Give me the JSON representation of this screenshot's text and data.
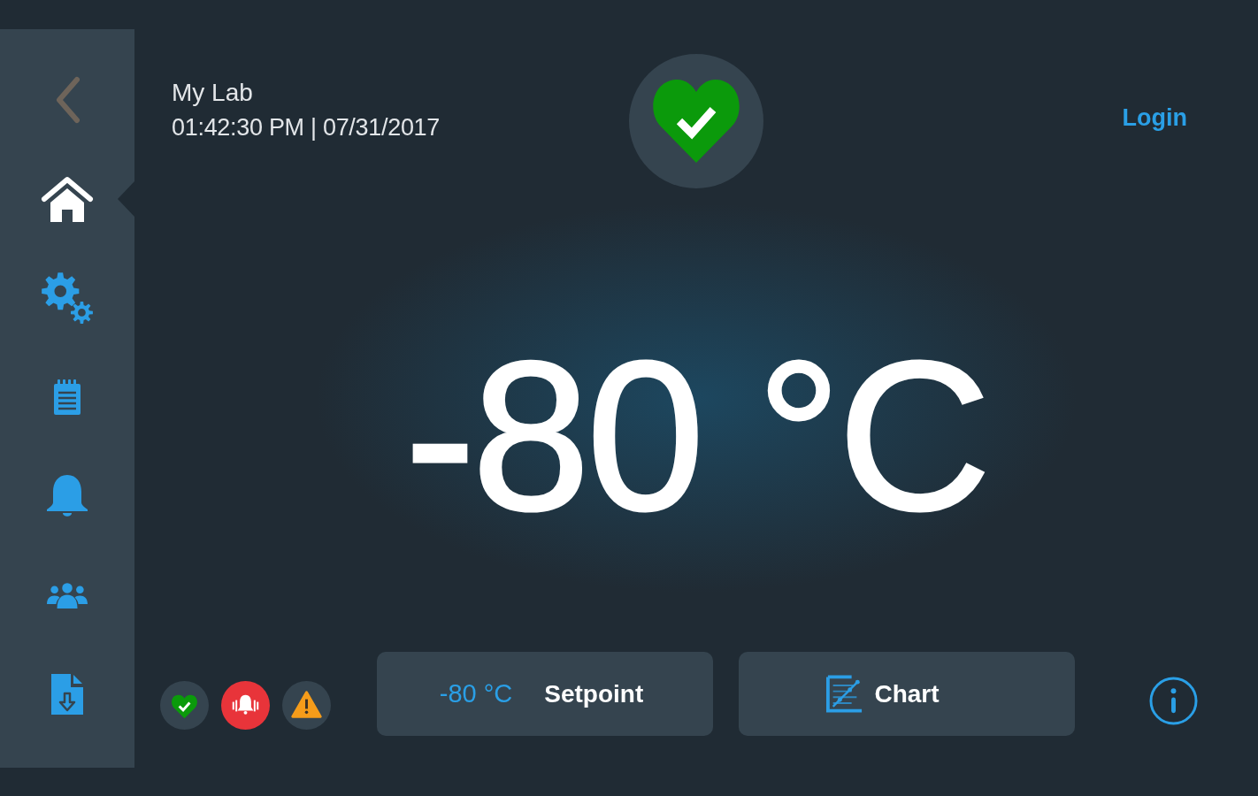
{
  "sidebar": {
    "back_button": {
      "disabled": true
    },
    "items": [
      {
        "kind": "home",
        "selected": true
      },
      {
        "kind": "settings",
        "selected": false
      },
      {
        "kind": "log",
        "selected": false
      },
      {
        "kind": "alarms",
        "selected": false
      },
      {
        "kind": "users",
        "selected": false
      },
      {
        "kind": "export",
        "selected": false
      }
    ]
  },
  "header": {
    "location": "My Lab",
    "datetime": "01:42:30 PM | 07/31/2017",
    "status": {
      "kind": "ok"
    },
    "login": "Login"
  },
  "temperature": {
    "reading": "-80 °C"
  },
  "indicators": [
    {
      "kind": "health",
      "active": false
    },
    {
      "kind": "alarm",
      "active": true
    },
    {
      "kind": "warning",
      "active": false
    }
  ],
  "actions": [
    {
      "kind": "setpoint",
      "value": "-80 °C",
      "label": "Setpoint"
    },
    {
      "kind": "chart",
      "label": "Chart"
    }
  ]
}
